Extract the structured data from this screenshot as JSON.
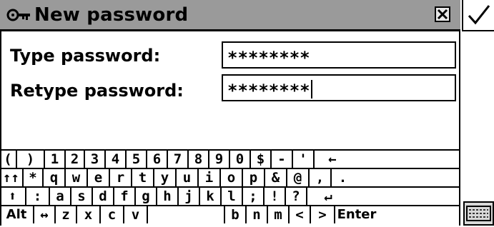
{
  "window": {
    "title": "New password",
    "title_icon": "key-icon",
    "close_icon": "close-x-icon",
    "ok_icon": "checkmark-icon"
  },
  "form": {
    "type_label": "Type password:",
    "type_value": "********",
    "retype_label": "Retype password:",
    "retype_value": "********"
  },
  "keyboard": {
    "rows": [
      [
        "(",
        ")",
        "1",
        "2",
        "3",
        "4",
        "5",
        "6",
        "7",
        "8",
        "9",
        "0",
        "$",
        "-",
        "'",
        "←"
      ],
      [
        "↑↑",
        "*",
        "q",
        "w",
        "e",
        "r",
        "t",
        "y",
        "u",
        "i",
        "o",
        "p",
        "&",
        "@",
        ",",
        "."
      ],
      [
        "⬆",
        ":",
        "a",
        "s",
        "d",
        "f",
        "g",
        "h",
        "j",
        "k",
        "l",
        ";",
        "!",
        "?",
        "↵"
      ],
      [
        "Alt",
        "↔",
        "z",
        "x",
        "c",
        "v",
        " ",
        "b",
        "n",
        "m",
        "<",
        ">",
        "Enter"
      ]
    ]
  },
  "side": {
    "keyboard_toggle_icon": "keyboard-icon"
  }
}
